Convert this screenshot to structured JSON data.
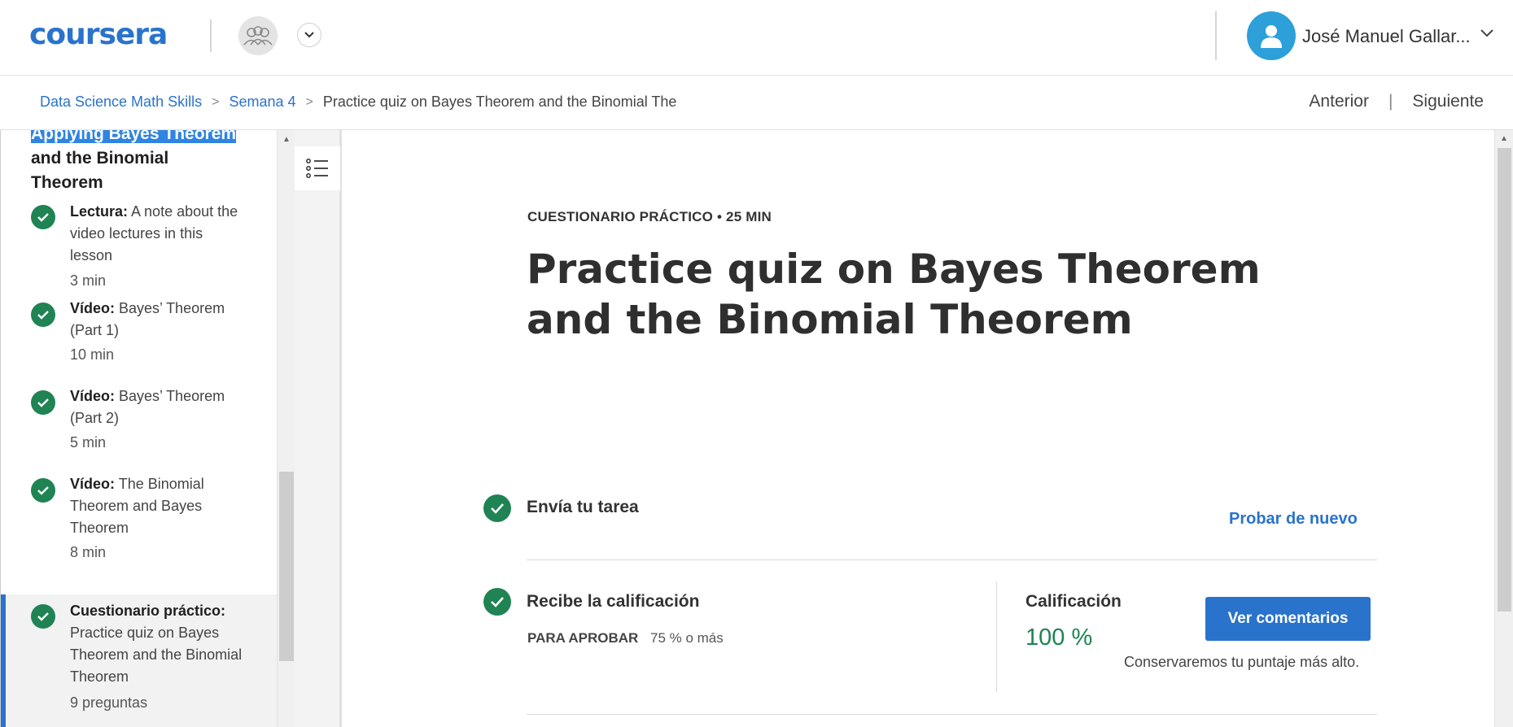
{
  "header": {
    "logo": "coursera",
    "user_name": "José Manuel Gallar..."
  },
  "breadcrumb": {
    "course": "Data Science Math Skills",
    "week": "Semana 4",
    "current": "Practice quiz on Bayes Theorem and the Binomial The",
    "separator": ">"
  },
  "nav": {
    "previous": "Anterior",
    "divider": "|",
    "next": "Siguiente"
  },
  "sidebar": {
    "section_title_highlight": "Applying Bayes Theorem",
    "section_title_rest": "and the Binomial Theorem",
    "items": [
      {
        "type": "Lectura:",
        "title": "A note about the video lectures in this lesson",
        "duration": "3 min"
      },
      {
        "type": "Vídeo:",
        "title": "Bayes’ Theorem (Part 1)",
        "duration": "10 min"
      },
      {
        "type": "Vídeo:",
        "title": "Bayes’ Theorem (Part 2)",
        "duration": "5 min"
      },
      {
        "type": "Vídeo:",
        "title": "The Binomial Theorem and Bayes Theorem",
        "duration": "8 min"
      },
      {
        "type": "Cuestionario práctico:",
        "title": "Practice quiz on Bayes Theorem and the Binomial Theorem",
        "duration": "9 preguntas"
      }
    ]
  },
  "main": {
    "kicker": "CUESTIONARIO PRÁCTICO • 25 MIN",
    "title": "Practice quiz on Bayes Theorem and the Binomial Theorem",
    "step1_title": "Envía tu tarea",
    "retry_link": "Probar de nuevo",
    "step2_title": "Recibe la calificación",
    "pass_label": "PARA APROBAR",
    "pass_value": "75 % o más",
    "grade_label": "Calificación",
    "grade_value": "100 %",
    "feedback_button": "Ver comentarios",
    "keep_note": "Conservaremos tu puntaje más alto."
  },
  "colors": {
    "brand": "#2a73cc",
    "success": "#1f8354",
    "avatar": "#2d9fd9"
  }
}
